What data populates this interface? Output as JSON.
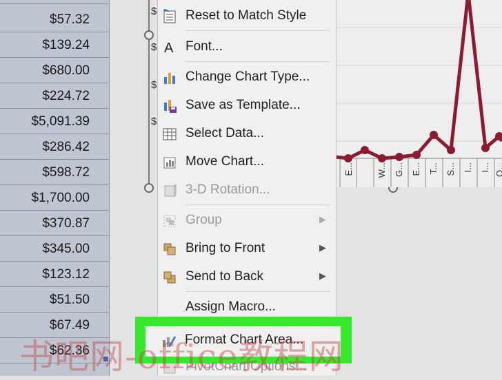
{
  "cells": [
    "$57.32",
    "$139.24",
    "$680.00",
    "$224.72",
    "$5,091.39",
    "$286.42",
    "$598.72",
    "$1,700.00",
    "$370.87",
    "$345.00",
    "$123.12",
    "$51.50",
    "$67.49",
    "$62.36"
  ],
  "axis": {
    "y_tick_glyph": "$"
  },
  "chart": {
    "category_labels": [
      "E...",
      "W...",
      "G...",
      "E...",
      "T...",
      "S...",
      "I...",
      "I...",
      "Q..."
    ]
  },
  "menu": {
    "items": [
      {
        "label": "Reset to Match Style",
        "icon": "reset-style-icon",
        "disabled": false,
        "submenu": false
      },
      {
        "label": "Font...",
        "icon": "font-icon",
        "disabled": false,
        "submenu": false
      },
      {
        "label": "Change Chart Type...",
        "icon": "change-chart-type-icon",
        "disabled": false,
        "submenu": false
      },
      {
        "label": "Save as Template...",
        "icon": "save-template-icon",
        "disabled": false,
        "submenu": false
      },
      {
        "label": "Select Data...",
        "icon": "select-data-icon",
        "disabled": false,
        "submenu": false
      },
      {
        "label": "Move Chart...",
        "icon": "move-chart-icon",
        "disabled": false,
        "submenu": false
      },
      {
        "label": "3-D Rotation...",
        "icon": "rotation-3d-icon",
        "disabled": true,
        "submenu": false
      },
      {
        "label": "Group",
        "icon": "group-icon",
        "disabled": true,
        "submenu": true
      },
      {
        "label": "Bring to Front",
        "icon": "bring-front-icon",
        "disabled": false,
        "submenu": true
      },
      {
        "label": "Send to Back",
        "icon": "send-back-icon",
        "disabled": false,
        "submenu": true
      },
      {
        "label": "Assign Macro...",
        "icon": "",
        "disabled": false,
        "submenu": false
      },
      {
        "label": "Format Chart Area...",
        "icon": "format-chart-area-icon",
        "disabled": false,
        "submenu": false
      },
      {
        "label": "PivotChart Options...",
        "icon": "pivotchart-options-icon",
        "disabled": true,
        "submenu": false
      }
    ]
  },
  "watermark": "书吧网-office教程网",
  "colors": {
    "series": "#8b1a33",
    "highlight": "#38e82d",
    "menu_bg": "#f0f0f0",
    "cell_bg": "#bfc6d1"
  }
}
